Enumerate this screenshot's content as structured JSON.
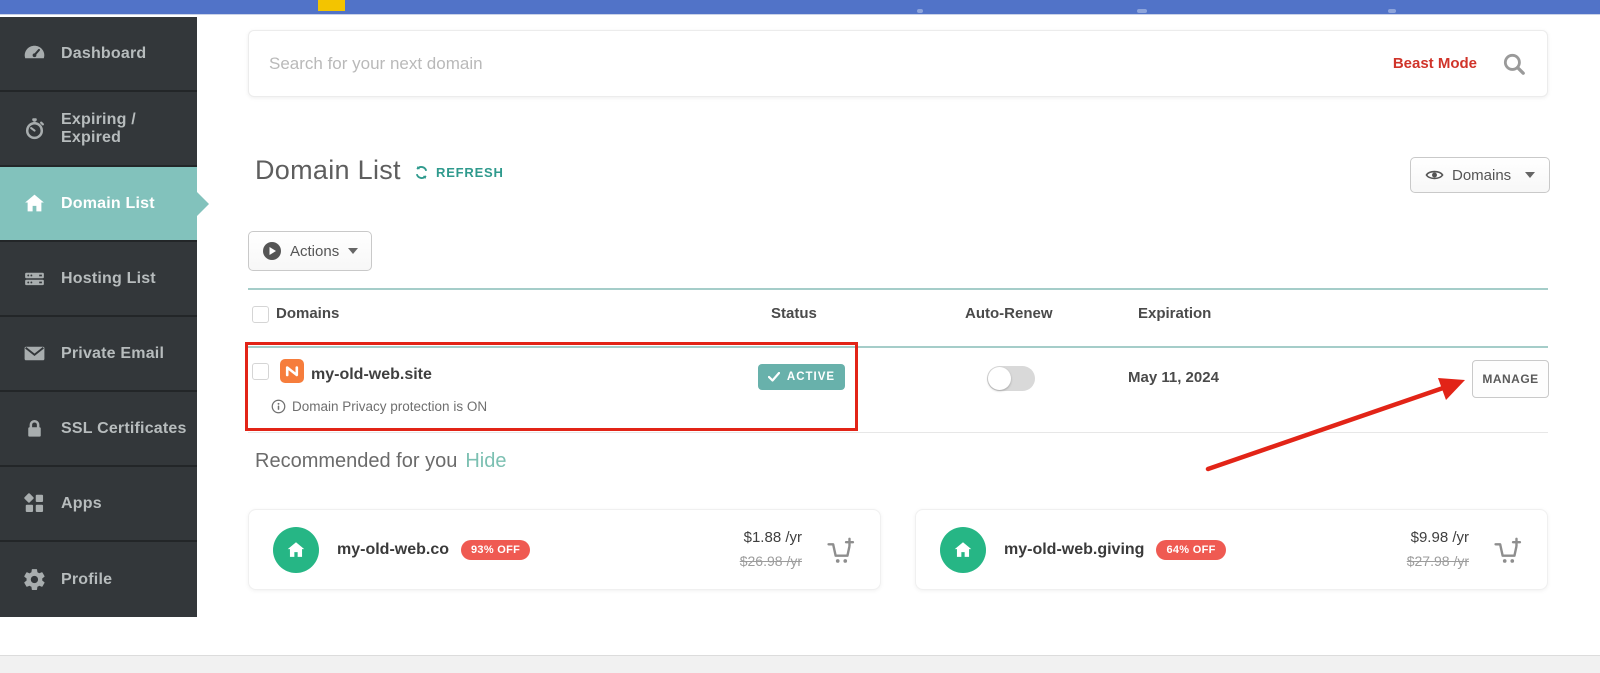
{
  "sidebar": {
    "items": [
      {
        "label": "Dashboard",
        "icon": "gauge"
      },
      {
        "label": "Expiring / Expired",
        "icon": "stopwatch"
      },
      {
        "label": "Domain List",
        "icon": "house",
        "active": true
      },
      {
        "label": "Hosting List",
        "icon": "server"
      },
      {
        "label": "Private Email",
        "icon": "envelope"
      },
      {
        "label": "SSL Certificates",
        "icon": "lock"
      },
      {
        "label": "Apps",
        "icon": "app-grid"
      },
      {
        "label": "Profile",
        "icon": "gear"
      }
    ]
  },
  "search": {
    "placeholder": "Search for your next domain",
    "beast_mode_label": "Beast Mode"
  },
  "header": {
    "title": "Domain List",
    "refresh_label": "REFRESH",
    "view_filter_label": "Domains"
  },
  "actions": {
    "label": "Actions"
  },
  "table": {
    "columns": {
      "domains": "Domains",
      "status": "Status",
      "auto_renew": "Auto-Renew",
      "expiration": "Expiration"
    },
    "row": {
      "domain": "my-old-web.site",
      "privacy_note": "Domain Privacy protection is ON",
      "status": "ACTIVE",
      "auto_renew": "off",
      "expiration": "May 11, 2024",
      "manage_label": "MANAGE"
    }
  },
  "recommended": {
    "title": "Recommended for you",
    "hide_label": "Hide",
    "cards": [
      {
        "domain": "my-old-web.co",
        "discount": "93% OFF",
        "price": "$1.88 /yr",
        "old_price": "$26.98 /yr"
      },
      {
        "domain": "my-old-web.giving",
        "discount": "64% OFF",
        "price": "$9.98 /yr",
        "old_price": "$27.98 /yr"
      }
    ]
  },
  "colors": {
    "topbar_blue": "#5173c8",
    "topbar_yellow": "#f3c400",
    "sidebar_dark": "#33373a",
    "active_teal": "#82c2bc",
    "badge_teal": "#68b1ab",
    "refresh_teal": "#2f9a8d",
    "annotation_red": "#e22417",
    "beast_red": "#d0342a",
    "discount_red": "#ef5a52",
    "avatar_green": "#26b685",
    "tile_orange": "#f67d3c"
  }
}
